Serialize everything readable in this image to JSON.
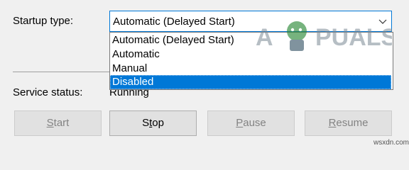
{
  "startup": {
    "label": "Startup type:",
    "selected_value": "Automatic (Delayed Start)",
    "options": [
      "Automatic (Delayed Start)",
      "Automatic",
      "Manual",
      "Disabled"
    ],
    "highlighted_index": 3
  },
  "status": {
    "label": "Service status:",
    "value": "Running"
  },
  "buttons": {
    "start": {
      "prefix": "",
      "underline": "S",
      "suffix": "tart",
      "enabled": false
    },
    "stop": {
      "prefix": "S",
      "underline": "t",
      "suffix": "op",
      "enabled": true
    },
    "pause": {
      "prefix": "",
      "underline": "P",
      "suffix": "ause",
      "enabled": false
    },
    "resume": {
      "prefix": "",
      "underline": "R",
      "suffix": "esume",
      "enabled": false
    }
  },
  "watermark": {
    "logo_text": "A PUALS",
    "site": "wsxdn.com"
  },
  "colors": {
    "accent": "#0078d7",
    "selection_text": "#ffffff",
    "disabled_text": "#838383",
    "background": "#f0f0f0"
  },
  "icons": {
    "dropdown": "chevron-down-icon"
  }
}
